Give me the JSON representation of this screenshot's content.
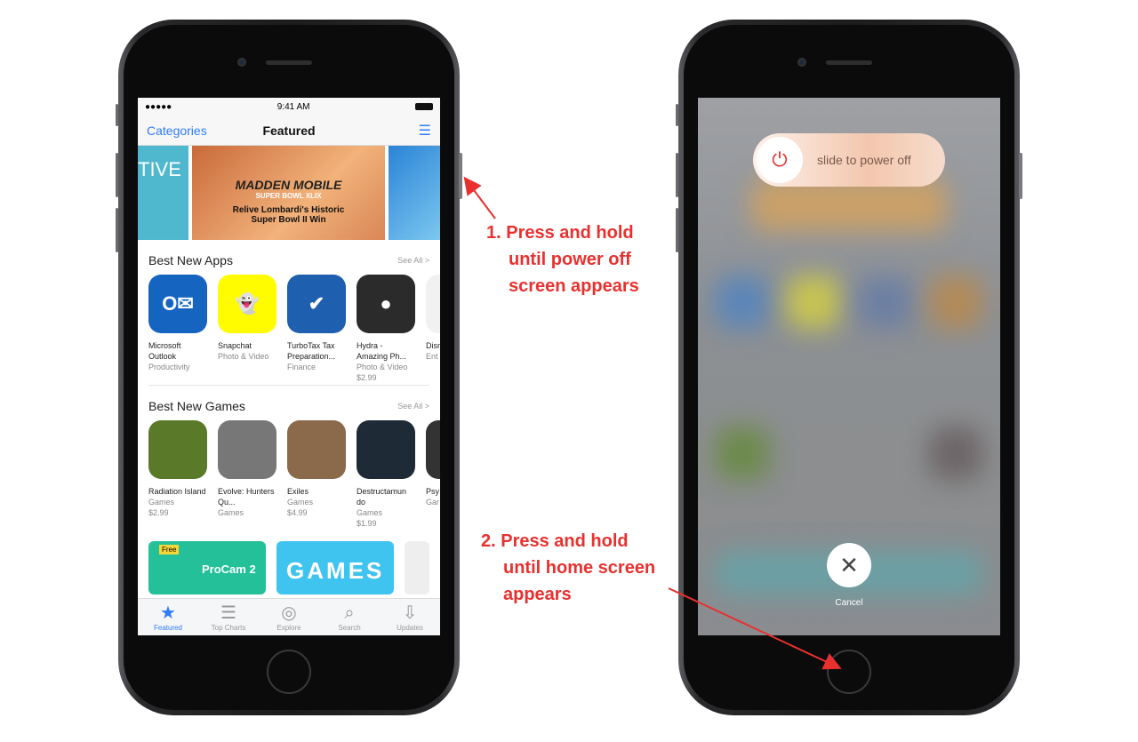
{
  "left_phone": {
    "status": {
      "time": "9:41 AM",
      "signal": "●●●●●",
      "wifi_icon": "wifi-icon",
      "battery_icon": "battery-icon"
    },
    "nav": {
      "left": "Categories",
      "title": "Featured",
      "right_icon": "list-icon"
    },
    "banners": [
      {
        "text": "TIVE"
      },
      {
        "logo": "MADDEN MOBILE",
        "subtitle": "SUPER BOWL XLIX",
        "caption": "Relive Lombardi's Historic Super Bowl II Win"
      },
      {
        "text": ""
      }
    ],
    "sections": [
      {
        "title": "Best New Apps",
        "see_all": "See All >",
        "items": [
          {
            "name": "Microsoft Outlook",
            "category": "Productivity",
            "price": "",
            "color": "#1565c0",
            "glyph": "O✉"
          },
          {
            "name": "Snapchat",
            "category": "Photo & Video",
            "price": "",
            "color": "#fffc00",
            "glyph": "👻"
          },
          {
            "name": "TurboTax Tax Preparation...",
            "category": "Finance",
            "price": "",
            "color": "#1f5fb0",
            "glyph": "✔"
          },
          {
            "name": "Hydra - Amazing Ph...",
            "category": "Photo & Video",
            "price": "$2.99",
            "color": "#2b2b2b",
            "glyph": "●"
          },
          {
            "name": "Disn Inqu",
            "category": "Ent",
            "price": "",
            "color": "#f1f1f1",
            "glyph": ""
          }
        ]
      },
      {
        "title": "Best New Games",
        "see_all": "See All >",
        "items": [
          {
            "name": "Radiation Island",
            "category": "Games",
            "price": "$2.99",
            "color": "#5a7a2a",
            "glyph": ""
          },
          {
            "name": "Evolve: Hunters Qu...",
            "category": "Games",
            "price": "",
            "color": "#777",
            "glyph": ""
          },
          {
            "name": "Exiles",
            "category": "Games",
            "price": "$4.99",
            "color": "#8a6a4a",
            "glyph": ""
          },
          {
            "name": "Destructamun do",
            "category": "Games",
            "price": "$1.99",
            "color": "#1e2a36",
            "glyph": ""
          },
          {
            "name": "Psy",
            "category": "Gar",
            "price": "",
            "color": "#333",
            "glyph": ""
          }
        ]
      }
    ],
    "promos": [
      {
        "badge": "Free",
        "title": "ProCam 2"
      },
      {
        "title": "GAMES"
      }
    ],
    "tabs": [
      {
        "label": "Featured",
        "icon": "★",
        "active": true
      },
      {
        "label": "Top Charts",
        "icon": "☰"
      },
      {
        "label": "Explore",
        "icon": "◎"
      },
      {
        "label": "Search",
        "icon": "⌕"
      },
      {
        "label": "Updates",
        "icon": "⇩"
      }
    ]
  },
  "right_phone": {
    "slider_label": "slide to power off",
    "power_icon": "power-icon",
    "cancel_label": "Cancel",
    "cancel_icon": "close-icon"
  },
  "annotations": [
    {
      "lines": [
        "1. Press and hold",
        "until power off",
        "screen appears"
      ]
    },
    {
      "lines": [
        "2. Press and hold",
        "until home screen",
        "appears"
      ]
    }
  ],
  "colors": {
    "accent": "#2f7cf6",
    "annotation": "#e8312f"
  }
}
